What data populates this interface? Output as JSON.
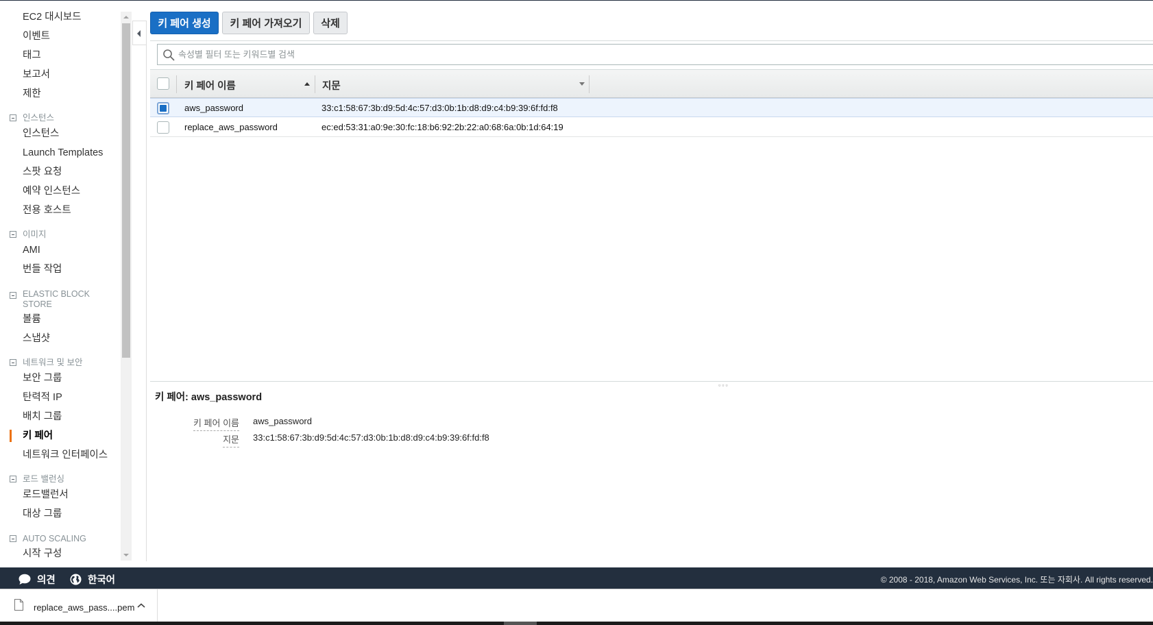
{
  "sidebar": {
    "items": {
      "dashboard": "EC2 대시보드",
      "events": "이벤트",
      "tags": "태그",
      "reports": "보고서",
      "limits": "제한",
      "instances": "인스턴스",
      "launch_templates": "Launch Templates",
      "spot_requests": "스팟 요청",
      "reserved_instances": "예약 인스턴스",
      "dedicated_hosts": "전용 호스트",
      "ami": "AMI",
      "bundle_tasks": "번들 작업",
      "volumes": "볼륨",
      "snapshots": "스냅샷",
      "security_groups": "보안 그룹",
      "elastic_ips": "탄력적 IP",
      "placement_groups": "배치 그룹",
      "key_pairs": "키 페어",
      "network_interfaces": "네트워크 인터페이스",
      "load_balancers": "로드밸런서",
      "target_groups": "대상 그룹",
      "launch_configurations": "시작 구성"
    },
    "sections": {
      "instances": "인스턴스",
      "images": "이미지",
      "ebs": "ELASTIC BLOCK STORE",
      "network_security": "네트워크 및 보안",
      "load_balancing": "로드 밸런싱",
      "auto_scaling": "AUTO SCALING"
    },
    "active_item": "키 페어"
  },
  "toolbar": {
    "create_label": "키 페어 생성",
    "import_label": "키 페어 가져오기",
    "delete_label": "삭제"
  },
  "search": {
    "placeholder": "속성별 필터 또는 키워드별 검색"
  },
  "table": {
    "columns": [
      "키 페어 이름",
      "지문"
    ],
    "rows": [
      {
        "name": "aws_password",
        "fingerprint": "33:c1:58:67:3b:d9:5d:4c:57:d3:0b:1b:d8:d9:c4:b9:39:6f:fd:f8",
        "selected": true
      },
      {
        "name": "replace_aws_password",
        "fingerprint": "ec:ed:53:31:a0:9e:30:fc:18:b6:92:2b:22:a0:68:6a:0b:1d:64:19",
        "selected": false
      }
    ]
  },
  "details": {
    "title": "키 페어: aws_password",
    "fields": [
      {
        "label": "키 페어 이름",
        "value": "aws_password"
      },
      {
        "label": "지문",
        "value": "33:c1:58:67:3b:d9:5d:4c:57:d3:0b:1b:d8:d9:c4:b9:39:6f:fd:f8"
      }
    ]
  },
  "footer": {
    "feedback_label": "의견",
    "language_label": "한국어",
    "copyright": "© 2008 - 2018, Amazon Web Services, Inc. 또는 자회사. All rights reserved."
  },
  "download": {
    "filename": "replace_aws_pass....pem"
  },
  "colors": {
    "accent": "#ec7211",
    "primary_button": "#1a6fc5",
    "footer_bg": "#232f3e",
    "selected_row": "#edf4fd"
  }
}
